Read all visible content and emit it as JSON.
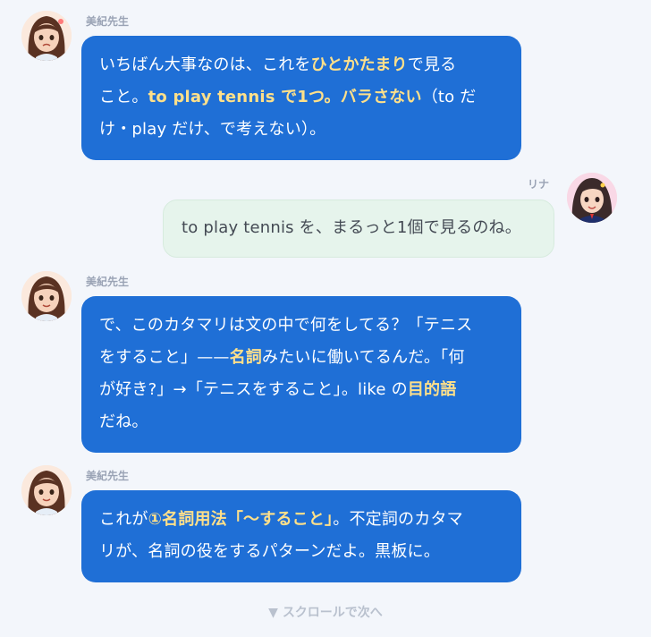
{
  "messages": [
    {
      "sender": "美紀先生",
      "segments": [
        {
          "text": "いちばん大事なのは、これを",
          "hl": false
        },
        {
          "text": "ひとかたまり",
          "hl": true
        },
        {
          "text": "で見る",
          "hl": false
        },
        {
          "br": true
        },
        {
          "text": "こと。",
          "hl": false
        },
        {
          "text": "to play tennis で1つ。バラさない",
          "hl": true
        },
        {
          "text": "（to だ",
          "hl": false
        },
        {
          "br": true
        },
        {
          "text": "け・play だけ、で考えない）。",
          "hl": false
        }
      ]
    },
    {
      "sender": "リナ",
      "text": "to play tennis を、まるっと1個で見るのね。"
    },
    {
      "sender": "美紀先生",
      "segments": [
        {
          "text": "で、このカタマリは文の中で何をしてる？「テニス",
          "hl": false
        },
        {
          "br": true
        },
        {
          "text": "をすること」——",
          "hl": false
        },
        {
          "text": "名詞",
          "hl": true
        },
        {
          "text": "みたいに働いてるんだ。「何",
          "hl": false
        },
        {
          "br": true
        },
        {
          "text": "が好き?」→「テニスをすること」。like の",
          "hl": false
        },
        {
          "text": "目的語",
          "hl": true
        },
        {
          "br": true
        },
        {
          "text": "だね。",
          "hl": false
        }
      ]
    },
    {
      "sender": "美紀先生",
      "segments": [
        {
          "text": "これが",
          "hl": false
        },
        {
          "text": "①名詞用法「〜すること」",
          "hl": true
        },
        {
          "text": "。不定詞のカタマ",
          "hl": false
        },
        {
          "br": true
        },
        {
          "text": "リが、名詞の役をするパターンだよ。黒板に。",
          "hl": false
        }
      ]
    }
  ],
  "hint": "▼ スクロールで次へ"
}
